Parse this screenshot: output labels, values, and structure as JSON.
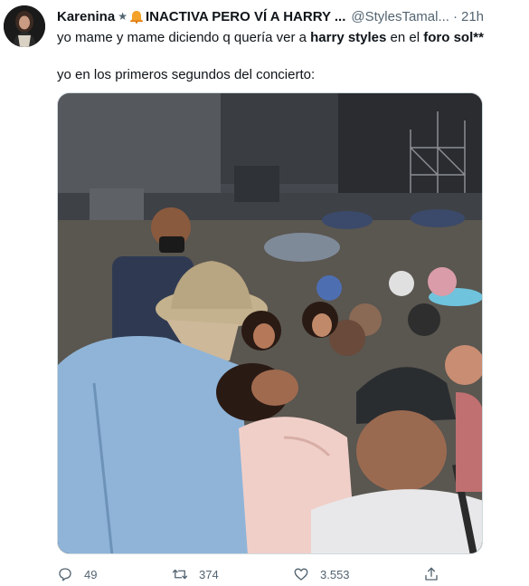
{
  "tweet": {
    "author_name": "Karenina",
    "star": "★",
    "author_display_suffix": "INACTIVA PERO VÍ A HARRY ...",
    "handle": "@StylesTamal...",
    "separator": "·",
    "time": "21h",
    "line1": {
      "part1": "yo mame y mame diciendo q quería ver a ",
      "bold1": "harry styles",
      "part2": " en el ",
      "bold2": "foro sol",
      "part3": "**"
    },
    "line2": "yo en los primeros segundos del concierto:"
  },
  "actions": {
    "reply_count": "49",
    "retweet_count": "374",
    "like_count": "3.553"
  },
  "icons": {
    "reply": "reply-icon",
    "retweet": "retweet-icon",
    "like": "heart-icon",
    "share": "share-icon",
    "bell": "bell-emoji-icon"
  },
  "colors": {
    "text": "#0f1419",
    "secondary": "#536471",
    "background": "#ffffff"
  }
}
